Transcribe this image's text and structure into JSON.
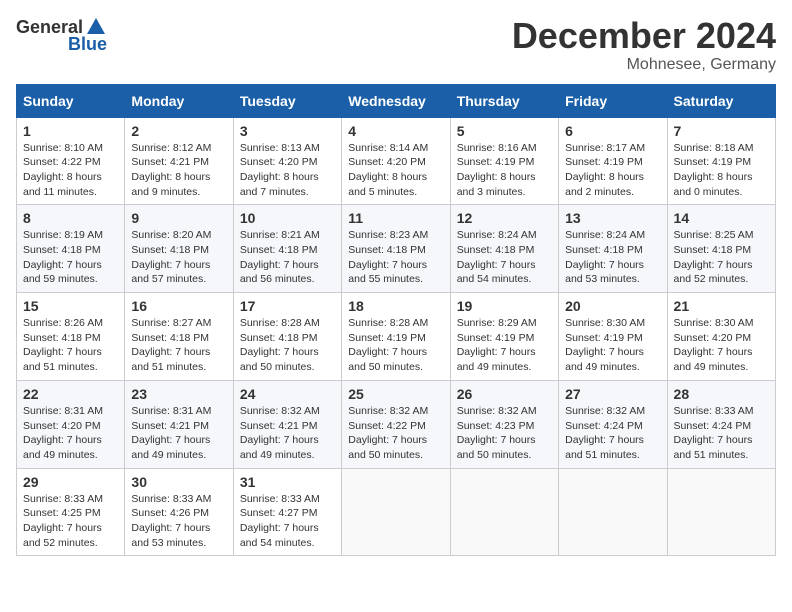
{
  "header": {
    "logo_general": "General",
    "logo_blue": "Blue",
    "month": "December 2024",
    "location": "Mohnesee, Germany"
  },
  "weekdays": [
    "Sunday",
    "Monday",
    "Tuesday",
    "Wednesday",
    "Thursday",
    "Friday",
    "Saturday"
  ],
  "weeks": [
    [
      {
        "day": "1",
        "sunrise": "Sunrise: 8:10 AM",
        "sunset": "Sunset: 4:22 PM",
        "daylight": "Daylight: 8 hours and 11 minutes."
      },
      {
        "day": "2",
        "sunrise": "Sunrise: 8:12 AM",
        "sunset": "Sunset: 4:21 PM",
        "daylight": "Daylight: 8 hours and 9 minutes."
      },
      {
        "day": "3",
        "sunrise": "Sunrise: 8:13 AM",
        "sunset": "Sunset: 4:20 PM",
        "daylight": "Daylight: 8 hours and 7 minutes."
      },
      {
        "day": "4",
        "sunrise": "Sunrise: 8:14 AM",
        "sunset": "Sunset: 4:20 PM",
        "daylight": "Daylight: 8 hours and 5 minutes."
      },
      {
        "day": "5",
        "sunrise": "Sunrise: 8:16 AM",
        "sunset": "Sunset: 4:19 PM",
        "daylight": "Daylight: 8 hours and 3 minutes."
      },
      {
        "day": "6",
        "sunrise": "Sunrise: 8:17 AM",
        "sunset": "Sunset: 4:19 PM",
        "daylight": "Daylight: 8 hours and 2 minutes."
      },
      {
        "day": "7",
        "sunrise": "Sunrise: 8:18 AM",
        "sunset": "Sunset: 4:19 PM",
        "daylight": "Daylight: 8 hours and 0 minutes."
      }
    ],
    [
      {
        "day": "8",
        "sunrise": "Sunrise: 8:19 AM",
        "sunset": "Sunset: 4:18 PM",
        "daylight": "Daylight: 7 hours and 59 minutes."
      },
      {
        "day": "9",
        "sunrise": "Sunrise: 8:20 AM",
        "sunset": "Sunset: 4:18 PM",
        "daylight": "Daylight: 7 hours and 57 minutes."
      },
      {
        "day": "10",
        "sunrise": "Sunrise: 8:21 AM",
        "sunset": "Sunset: 4:18 PM",
        "daylight": "Daylight: 7 hours and 56 minutes."
      },
      {
        "day": "11",
        "sunrise": "Sunrise: 8:23 AM",
        "sunset": "Sunset: 4:18 PM",
        "daylight": "Daylight: 7 hours and 55 minutes."
      },
      {
        "day": "12",
        "sunrise": "Sunrise: 8:24 AM",
        "sunset": "Sunset: 4:18 PM",
        "daylight": "Daylight: 7 hours and 54 minutes."
      },
      {
        "day": "13",
        "sunrise": "Sunrise: 8:24 AM",
        "sunset": "Sunset: 4:18 PM",
        "daylight": "Daylight: 7 hours and 53 minutes."
      },
      {
        "day": "14",
        "sunrise": "Sunrise: 8:25 AM",
        "sunset": "Sunset: 4:18 PM",
        "daylight": "Daylight: 7 hours and 52 minutes."
      }
    ],
    [
      {
        "day": "15",
        "sunrise": "Sunrise: 8:26 AM",
        "sunset": "Sunset: 4:18 PM",
        "daylight": "Daylight: 7 hours and 51 minutes."
      },
      {
        "day": "16",
        "sunrise": "Sunrise: 8:27 AM",
        "sunset": "Sunset: 4:18 PM",
        "daylight": "Daylight: 7 hours and 51 minutes."
      },
      {
        "day": "17",
        "sunrise": "Sunrise: 8:28 AM",
        "sunset": "Sunset: 4:18 PM",
        "daylight": "Daylight: 7 hours and 50 minutes."
      },
      {
        "day": "18",
        "sunrise": "Sunrise: 8:28 AM",
        "sunset": "Sunset: 4:19 PM",
        "daylight": "Daylight: 7 hours and 50 minutes."
      },
      {
        "day": "19",
        "sunrise": "Sunrise: 8:29 AM",
        "sunset": "Sunset: 4:19 PM",
        "daylight": "Daylight: 7 hours and 49 minutes."
      },
      {
        "day": "20",
        "sunrise": "Sunrise: 8:30 AM",
        "sunset": "Sunset: 4:19 PM",
        "daylight": "Daylight: 7 hours and 49 minutes."
      },
      {
        "day": "21",
        "sunrise": "Sunrise: 8:30 AM",
        "sunset": "Sunset: 4:20 PM",
        "daylight": "Daylight: 7 hours and 49 minutes."
      }
    ],
    [
      {
        "day": "22",
        "sunrise": "Sunrise: 8:31 AM",
        "sunset": "Sunset: 4:20 PM",
        "daylight": "Daylight: 7 hours and 49 minutes."
      },
      {
        "day": "23",
        "sunrise": "Sunrise: 8:31 AM",
        "sunset": "Sunset: 4:21 PM",
        "daylight": "Daylight: 7 hours and 49 minutes."
      },
      {
        "day": "24",
        "sunrise": "Sunrise: 8:32 AM",
        "sunset": "Sunset: 4:21 PM",
        "daylight": "Daylight: 7 hours and 49 minutes."
      },
      {
        "day": "25",
        "sunrise": "Sunrise: 8:32 AM",
        "sunset": "Sunset: 4:22 PM",
        "daylight": "Daylight: 7 hours and 50 minutes."
      },
      {
        "day": "26",
        "sunrise": "Sunrise: 8:32 AM",
        "sunset": "Sunset: 4:23 PM",
        "daylight": "Daylight: 7 hours and 50 minutes."
      },
      {
        "day": "27",
        "sunrise": "Sunrise: 8:32 AM",
        "sunset": "Sunset: 4:24 PM",
        "daylight": "Daylight: 7 hours and 51 minutes."
      },
      {
        "day": "28",
        "sunrise": "Sunrise: 8:33 AM",
        "sunset": "Sunset: 4:24 PM",
        "daylight": "Daylight: 7 hours and 51 minutes."
      }
    ],
    [
      {
        "day": "29",
        "sunrise": "Sunrise: 8:33 AM",
        "sunset": "Sunset: 4:25 PM",
        "daylight": "Daylight: 7 hours and 52 minutes."
      },
      {
        "day": "30",
        "sunrise": "Sunrise: 8:33 AM",
        "sunset": "Sunset: 4:26 PM",
        "daylight": "Daylight: 7 hours and 53 minutes."
      },
      {
        "day": "31",
        "sunrise": "Sunrise: 8:33 AM",
        "sunset": "Sunset: 4:27 PM",
        "daylight": "Daylight: 7 hours and 54 minutes."
      },
      null,
      null,
      null,
      null
    ]
  ]
}
